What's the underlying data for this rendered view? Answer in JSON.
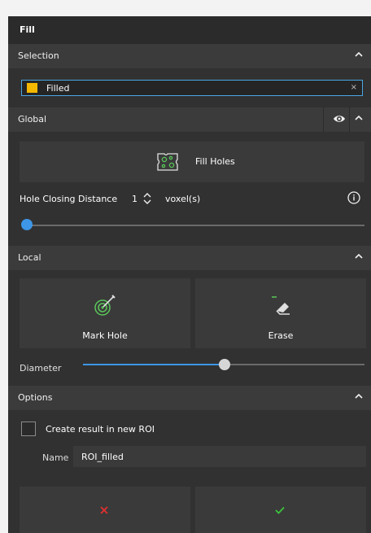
{
  "panel": {
    "title": "Fill"
  },
  "selection": {
    "header": "Selection",
    "item_label": "Filled",
    "item_color": "#f5b800",
    "clear_symbol": "×"
  },
  "global": {
    "header": "Global",
    "fill_holes_label": "Fill Holes",
    "hole_closing_label": "Hole Closing Distance",
    "hole_closing_value": "1",
    "hole_closing_unit": "voxel(s)",
    "hole_closing_slider_fraction": 0.0
  },
  "local": {
    "header": "Local",
    "mark_hole_label": "Mark Hole",
    "erase_label": "Erase",
    "diameter_label": "Diameter",
    "diameter_slider_fraction": 0.5
  },
  "options": {
    "header": "Options",
    "create_new_roi_label": "Create result in new ROI",
    "create_new_roi_checked": false,
    "name_label": "Name",
    "name_value": "ROI_filled"
  },
  "actions": {
    "cancel_icon": "x-icon",
    "cancel_color": "#e03030",
    "ok_icon": "checkmark-icon",
    "ok_color": "#3cc43c"
  },
  "colors": {
    "accent": "#3d96e6",
    "selection_border": "#4aa6e4"
  }
}
